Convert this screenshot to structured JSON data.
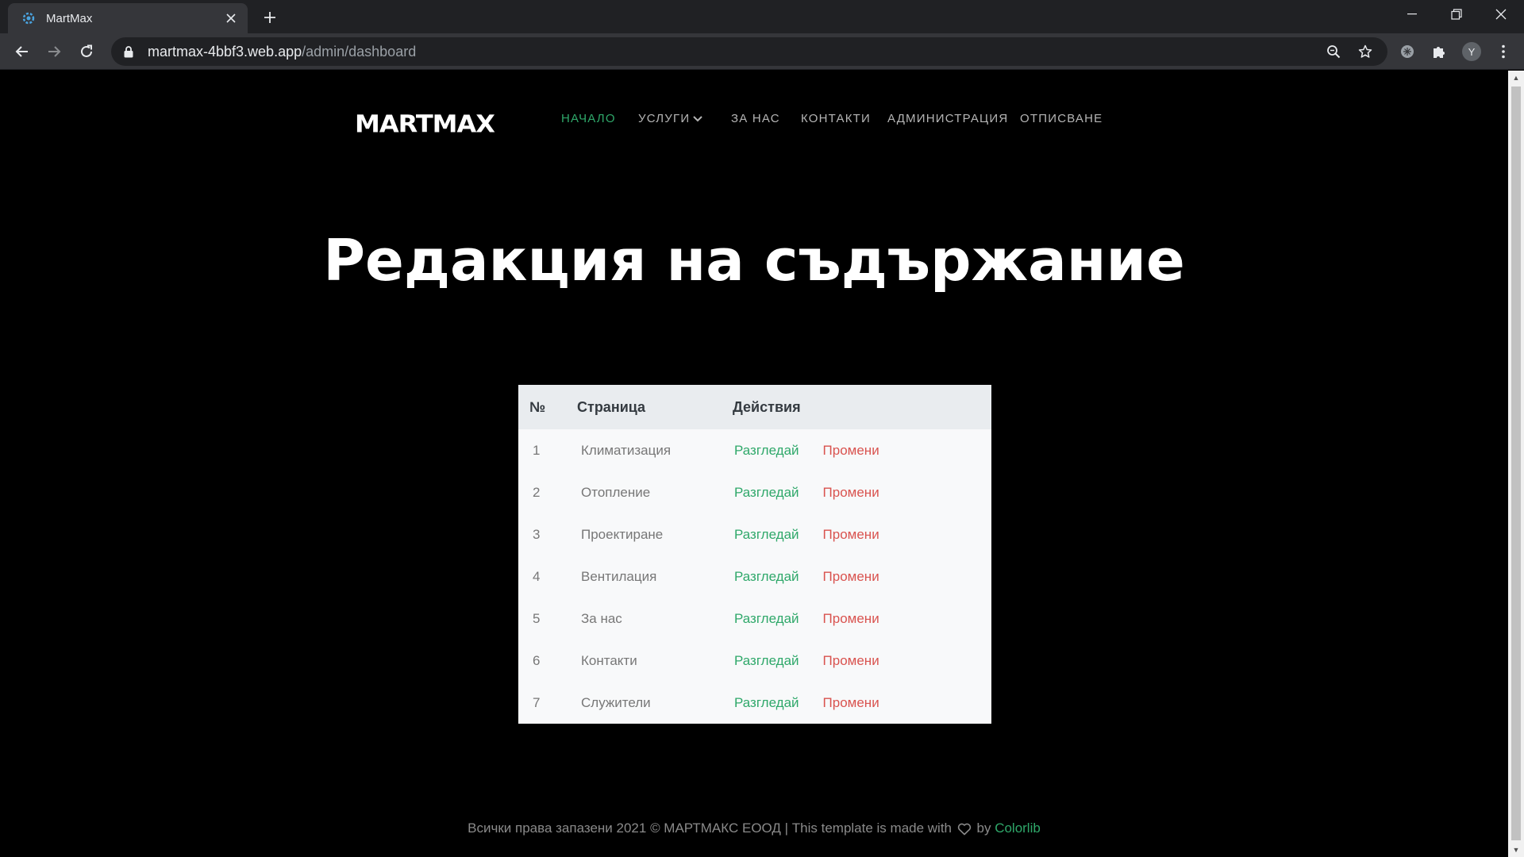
{
  "browser": {
    "tab_title": "MartMax",
    "url_domain": "martmax-4bbf3.web.app",
    "url_path": "/admin/dashboard",
    "profile_initial": "Y"
  },
  "site": {
    "logo": "MARTMAX",
    "nav": [
      {
        "label": "НАЧАЛО",
        "active": true
      },
      {
        "label": "УСЛУГИ",
        "active": false,
        "dropdown": true
      },
      {
        "label": "ЗА НАС",
        "active": false
      },
      {
        "label": "КОНТАКТИ",
        "active": false
      },
      {
        "label": "АДМИНИСТРАЦИЯ",
        "active": false
      },
      {
        "label": "ОТПИСВАНЕ",
        "active": false
      }
    ],
    "heading": "Редакция на съдържание",
    "table": {
      "headers": [
        "№",
        "Страница",
        "Действия"
      ],
      "view_label": "Разгледай",
      "edit_label": "Промени",
      "rows": [
        {
          "num": "1",
          "page": "Климатизация"
        },
        {
          "num": "2",
          "page": "Отопление"
        },
        {
          "num": "3",
          "page": "Проектиране"
        },
        {
          "num": "4",
          "page": "Вентилация"
        },
        {
          "num": "5",
          "page": "За нас"
        },
        {
          "num": "6",
          "page": "Контакти"
        },
        {
          "num": "7",
          "page": "Служители"
        }
      ]
    },
    "footer": {
      "text": "Всички права запазени 2021 © МАРТМАКС ЕООД | This template is made with",
      "by": "by",
      "link": "Colorlib"
    }
  },
  "colors": {
    "accent_green": "#2fa86a",
    "edit_red": "#d9534f",
    "page_bg": "#000000"
  }
}
